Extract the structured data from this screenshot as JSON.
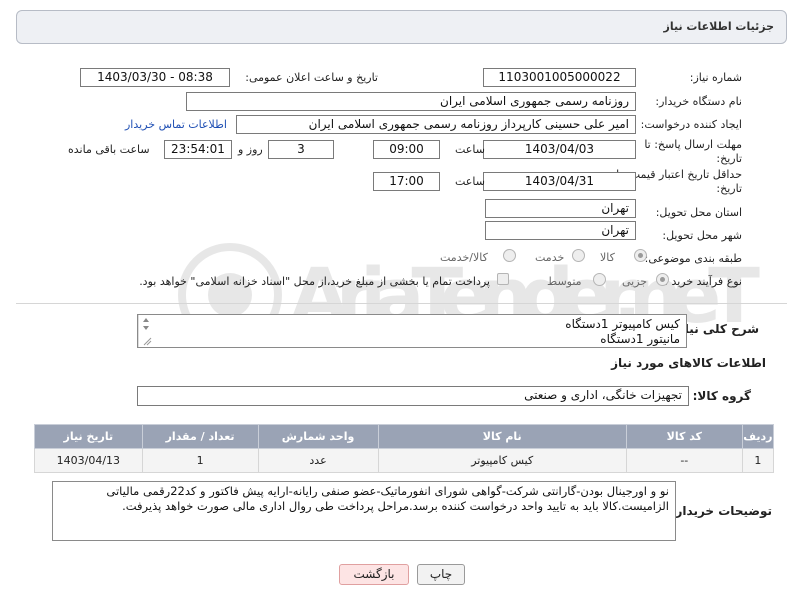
{
  "header": {
    "title": "جزئیات اطلاعات نیاز"
  },
  "fields": {
    "need_number_label": "شماره نیاز:",
    "need_number": "1103001005000022",
    "announce_label": "تاریخ و ساعت اعلان عمومی:",
    "announce_value": "1403/03/30 - 08:38",
    "buyer_org_label": "نام دستگاه خریدار:",
    "buyer_org": "روزنامه رسمی جمهوری اسلامی ایران",
    "creator_label": "ایجاد کننده درخواست:",
    "creator": "امیر علی حسینی کارپرداز روزنامه رسمی جمهوری اسلامی ایران",
    "contact_link": "اطلاعات تماس خریدار",
    "deadline_label": "مهلت ارسال پاسخ: تا تاریخ:",
    "deadline_date": "1403/04/03",
    "time_label": "ساعت",
    "deadline_time": "09:00",
    "days_value": "3",
    "days_label": "روز و",
    "remaining_time": "23:54:01",
    "remaining_label": "ساعت باقی مانده",
    "validity_label": "حداقل تاریخ اعتبار قیمت: تا تاریخ:",
    "validity_date": "1403/04/31",
    "validity_time": "17:00",
    "province_label": "استان محل تحویل:",
    "province": "تهران",
    "city_label": "شهر محل تحویل:",
    "city": "تهران",
    "category_label": "طبقه بندی موضوعی:",
    "category_options": [
      "کالا",
      "خدمت",
      "کالا/خدمت"
    ],
    "process_label": "نوع فرآیند خرید :",
    "process_options": [
      "جزیی",
      "متوسط"
    ],
    "payment_note": "پرداخت تمام یا بخشی از مبلغ خرید،از محل \"اسناد خزانه اسلامی\" خواهد بود."
  },
  "description": {
    "label": "شرح کلی نیاز:",
    "lines": [
      "کیس کامپیوتر 1دستگاه",
      "مانیتور 1دستگاه"
    ]
  },
  "goods": {
    "section_title": "اطلاعات کالاهای مورد نیاز",
    "group_label": "گروه کالا:",
    "group_value": "تجهیزات خانگی، اداری و صنعتی",
    "columns": [
      "ردیف",
      "کد کالا",
      "نام کالا",
      "واحد شمارش",
      "تعداد / مقدار",
      "تاریخ نیاز"
    ],
    "rows": [
      [
        "1",
        "--",
        "کیس کامپیوتر",
        "عدد",
        "1",
        "1403/04/13"
      ]
    ]
  },
  "buyer_notes": {
    "label": "توضیحات خریدار:",
    "text": "نو و اورجینال بودن-گارانتی شرکت-گواهی شورای انفورماتیک-عضو صنفی رایانه-ارایه پیش فاکتور و کد22رقمی مالیاتی الزامیست.کالا باید به تایید واحد درخواست کننده برسد.مراحل پرداخت طی روال اداری مالی صورت خواهد پذیرفت."
  },
  "buttons": {
    "print": "چاپ",
    "back": "بازگشت"
  },
  "watermark": "AriaTender.neT"
}
